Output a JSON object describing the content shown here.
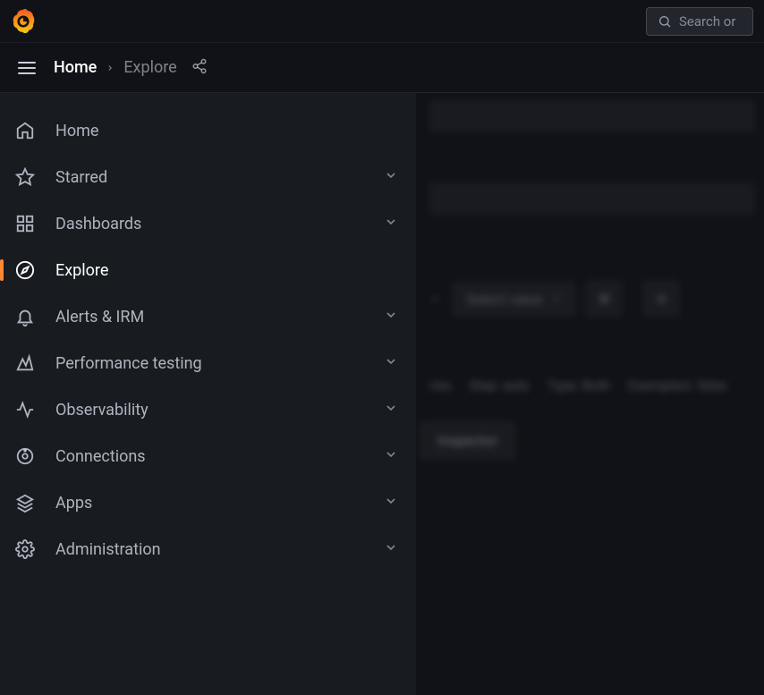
{
  "header": {
    "search_placeholder": "Search or"
  },
  "breadcrumb": {
    "home": "Home",
    "current": "Explore"
  },
  "sidebar": {
    "items": [
      {
        "label": "Home",
        "expandable": false,
        "active": false
      },
      {
        "label": "Starred",
        "expandable": true,
        "active": false
      },
      {
        "label": "Dashboards",
        "expandable": true,
        "active": false
      },
      {
        "label": "Explore",
        "expandable": false,
        "active": true
      },
      {
        "label": "Alerts & IRM",
        "expandable": true,
        "active": false
      },
      {
        "label": "Performance testing",
        "expandable": true,
        "active": false
      },
      {
        "label": "Observability",
        "expandable": true,
        "active": false
      },
      {
        "label": "Connections",
        "expandable": true,
        "active": false
      },
      {
        "label": "Apps",
        "expandable": true,
        "active": false
      },
      {
        "label": "Administration",
        "expandable": true,
        "active": false
      }
    ]
  },
  "main": {
    "select_value": "Select value",
    "options": {
      "series": "ries",
      "step": "Step: auto",
      "type": "Type: Both",
      "exemplars": "Exemplars: false"
    },
    "inspector_label": "Inspector"
  }
}
